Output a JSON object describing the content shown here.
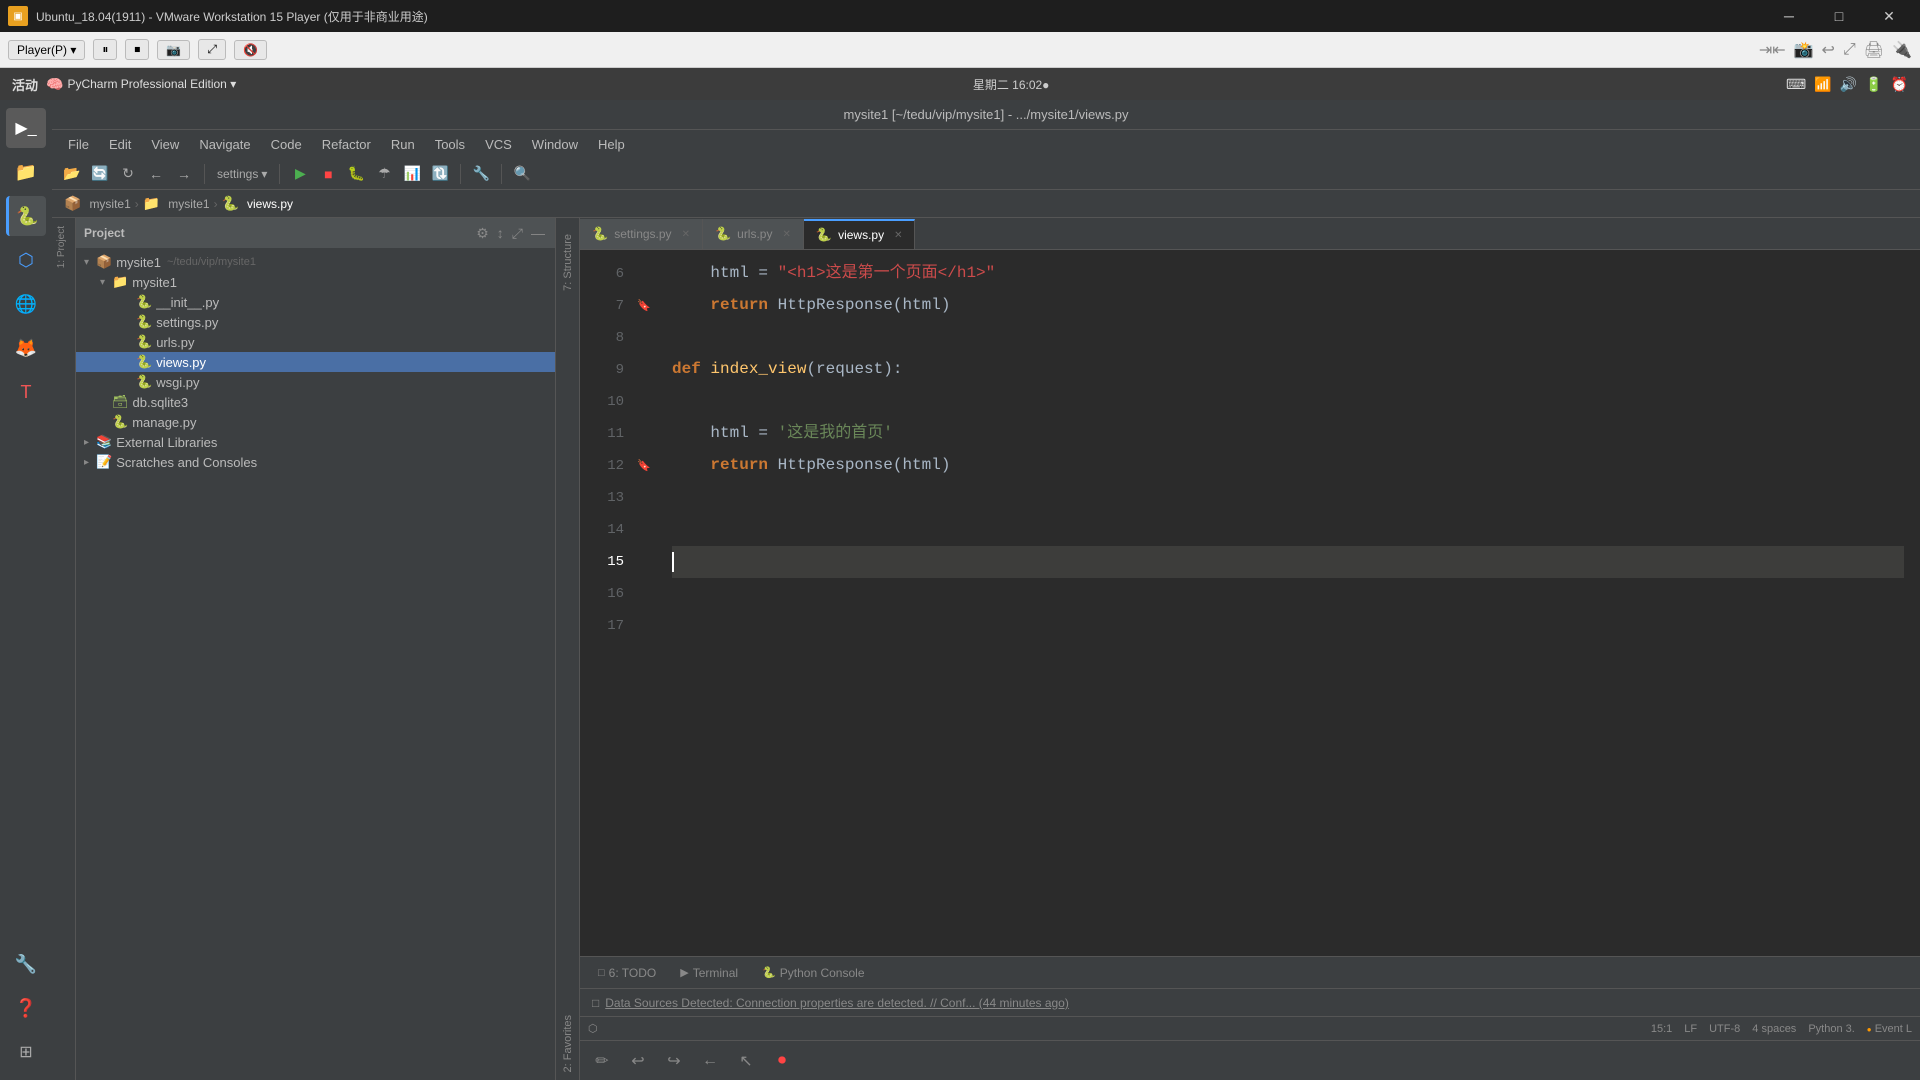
{
  "window": {
    "title": "Ubuntu_18.04(1911) - VMware Workstation 15 Player (仅用于非商业用途)",
    "icon": "▣"
  },
  "vmware_toolbar": {
    "player_label": "Player(P) ▾",
    "buttons": [
      "⏸",
      "⏹",
      "📷",
      "⤢",
      "🔇"
    ]
  },
  "ubuntu_bar": {
    "app_name": "PyCharm Professional Edition ▾",
    "datetime": "星期二 16:02●",
    "right_icons": [
      "⌨",
      "📶",
      "🔊",
      "🔋",
      "⏰"
    ]
  },
  "pycharm": {
    "title": "mysite1 [~/tedu/vip/mysite1] - .../mysite1/views.py",
    "menu": {
      "items": [
        "File",
        "Edit",
        "View",
        "Navigate",
        "Code",
        "Refactor",
        "Run",
        "Tools",
        "VCS",
        "Window",
        "Help"
      ]
    },
    "toolbar": {
      "breadcrumb": [
        "mysite1",
        "mysite1",
        "views.py"
      ]
    },
    "tabs": [
      {
        "label": "settings.py",
        "modified": true,
        "active": false
      },
      {
        "label": "urls.py",
        "active": false,
        "modified": false
      },
      {
        "label": "views.py",
        "active": true,
        "modified": false
      }
    ],
    "project_panel": {
      "title": "Project",
      "tree": [
        {
          "label": "mysite1",
          "indent": 0,
          "type": "root",
          "path": "~/tedu/vip/mysite1",
          "expanded": true
        },
        {
          "label": "mysite1",
          "indent": 1,
          "type": "folder",
          "expanded": true
        },
        {
          "label": "__init__.py",
          "indent": 2,
          "type": "file"
        },
        {
          "label": "settings.py",
          "indent": 2,
          "type": "file"
        },
        {
          "label": "urls.py",
          "indent": 2,
          "type": "file"
        },
        {
          "label": "views.py",
          "indent": 2,
          "type": "file",
          "selected": true
        },
        {
          "label": "wsgi.py",
          "indent": 2,
          "type": "file"
        },
        {
          "label": "db.sqlite3",
          "indent": 1,
          "type": "file"
        },
        {
          "label": "manage.py",
          "indent": 1,
          "type": "file"
        },
        {
          "label": "External Libraries",
          "indent": 0,
          "type": "folder",
          "expanded": false
        },
        {
          "label": "Scratches and Consoles",
          "indent": 0,
          "type": "folder",
          "expanded": false
        }
      ]
    },
    "code": {
      "lines": [
        {
          "num": 6,
          "content": "    html = \"<h1>这是第一个页面</h1>\"",
          "type": "normal"
        },
        {
          "num": 7,
          "content": "    return HttpResponse(html)",
          "type": "normal"
        },
        {
          "num": 8,
          "content": "",
          "type": "empty"
        },
        {
          "num": 9,
          "content": "def index_view(request):",
          "type": "normal"
        },
        {
          "num": 10,
          "content": "",
          "type": "empty"
        },
        {
          "num": 11,
          "content": "    html = '这是我的首页'",
          "type": "normal"
        },
        {
          "num": 12,
          "content": "    return HttpResponse(html)",
          "type": "normal"
        },
        {
          "num": 13,
          "content": "",
          "type": "empty"
        },
        {
          "num": 14,
          "content": "",
          "type": "empty"
        },
        {
          "num": 15,
          "content": "",
          "type": "cursor"
        },
        {
          "num": 16,
          "content": "",
          "type": "empty"
        },
        {
          "num": 17,
          "content": "",
          "type": "empty"
        }
      ]
    },
    "bottom_tabs": [
      {
        "label": "6: TODO",
        "active": false,
        "dot_color": "#888"
      },
      {
        "label": "Terminal",
        "active": false,
        "dot_color": "#888"
      },
      {
        "label": "Python Console",
        "active": false,
        "dot_color": "#888"
      }
    ],
    "notification": "Data Sources Detected: Connection properties are detected. // Conf... (44 minutes ago)",
    "status_right": "15:1  LF  UTF-8  4 spaces  Python 3.   Event L",
    "vertical_tabs": [
      "1: Project",
      "7: Structure",
      "2: Favorites"
    ]
  },
  "colors": {
    "bg_dark": "#2b2b2b",
    "bg_panel": "#3c3f41",
    "bg_selected": "#4a6fa5",
    "accent": "#4a9eff",
    "kw_color": "#cc7832",
    "str_color_red": "#cc4b4b",
    "str_color_green": "#6a8759",
    "fn_color": "#ffc66d",
    "normal_text": "#a9b7c6"
  }
}
